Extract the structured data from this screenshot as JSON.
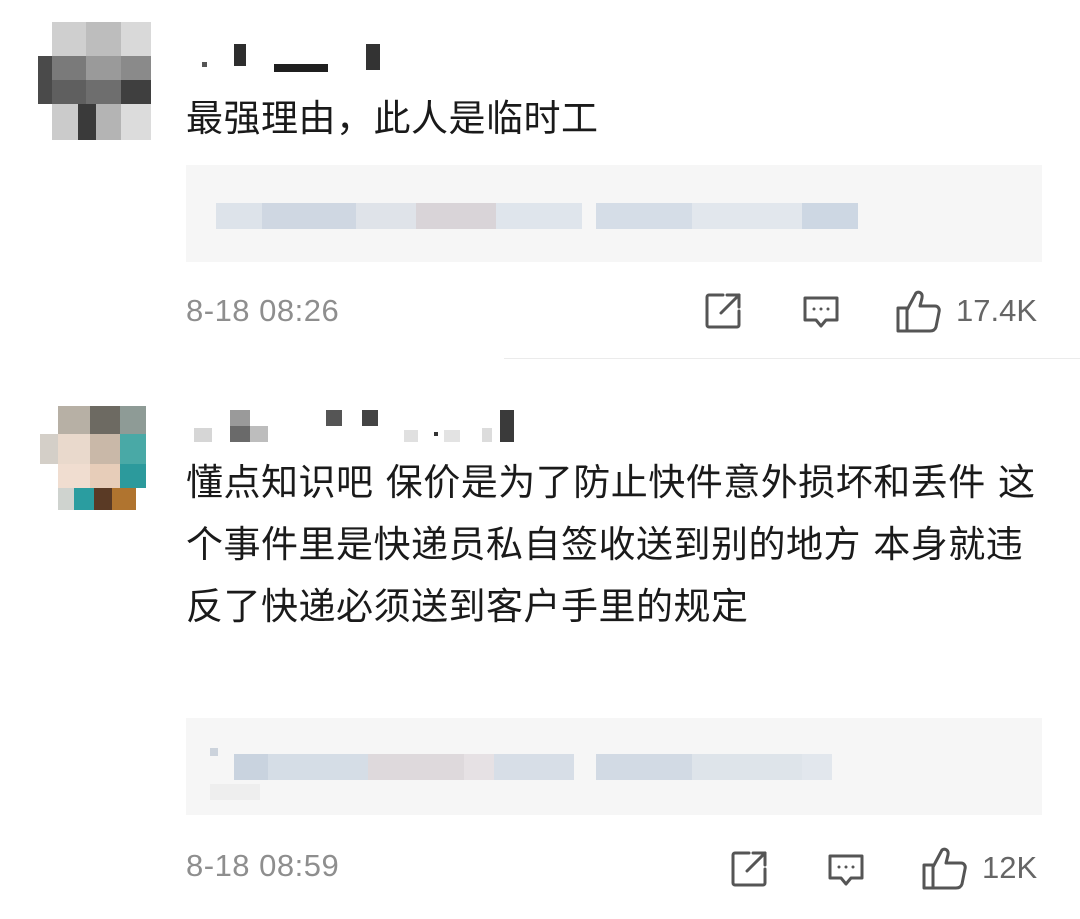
{
  "comments": [
    {
      "text": "最强理由，此人是临时工",
      "timestamp": "8-18 08:26",
      "actions": {
        "share_icon": "share-icon",
        "reply_icon": "comment-icon",
        "like_icon": "thumbs-up-icon"
      },
      "likes": "17.4K"
    },
    {
      "text": "懂点知识吧 保价是为了防止快件意外损坏和丢件 这个事件里是快递员私自签收送到别的地方 本身就违反了快递必须送到客户手里的规定",
      "timestamp": "8-18 08:59",
      "actions": {
        "share_icon": "share-icon",
        "reply_icon": "comment-icon",
        "like_icon": "thumbs-up-icon"
      },
      "likes": "12K"
    }
  ],
  "colors": {
    "text": "#1a1a1a",
    "meta": "#8e8e8e",
    "icon": "#555555",
    "quote_background": "#f6f6f6"
  }
}
